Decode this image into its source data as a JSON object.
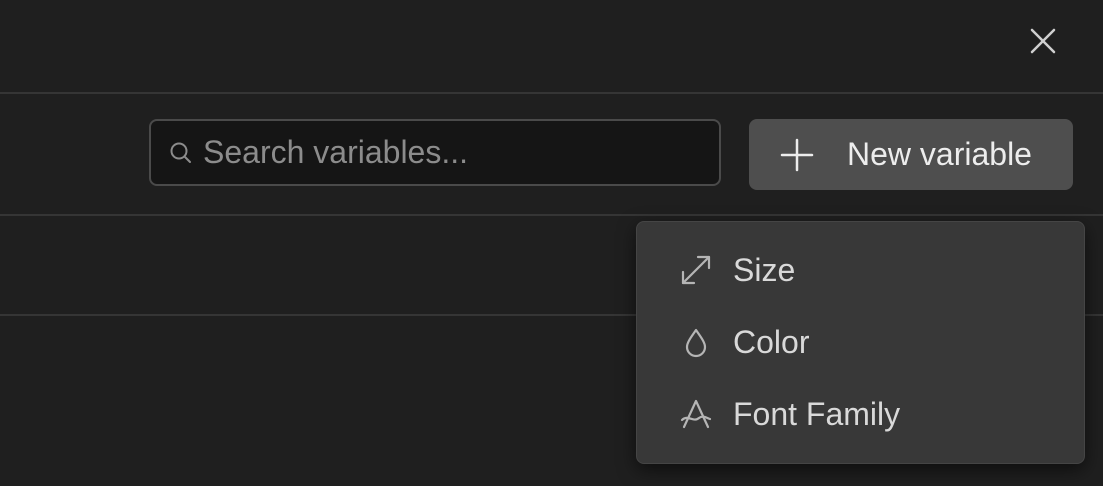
{
  "dialog": {
    "close_icon": "close-icon"
  },
  "toolbar": {
    "search": {
      "placeholder": "Search variables...",
      "value": "",
      "icon": "search-icon"
    },
    "new_variable_button": {
      "label": "New variable",
      "icon": "plus-icon"
    }
  },
  "dropdown": {
    "items": [
      {
        "label": "Size",
        "icon": "resize-diagonal-icon"
      },
      {
        "label": "Color",
        "icon": "droplet-icon"
      },
      {
        "label": "Font Family",
        "icon": "font-icon"
      }
    ]
  },
  "colors": {
    "background": "#1f1f1f",
    "divider": "#353535",
    "input_background": "#151515",
    "input_border": "#4a4a4a",
    "button_background": "#4e4e4e",
    "menu_background": "#383838",
    "text": "#e8e8e8",
    "placeholder": "#8c8c8c",
    "icon": "#b5b5b5"
  }
}
